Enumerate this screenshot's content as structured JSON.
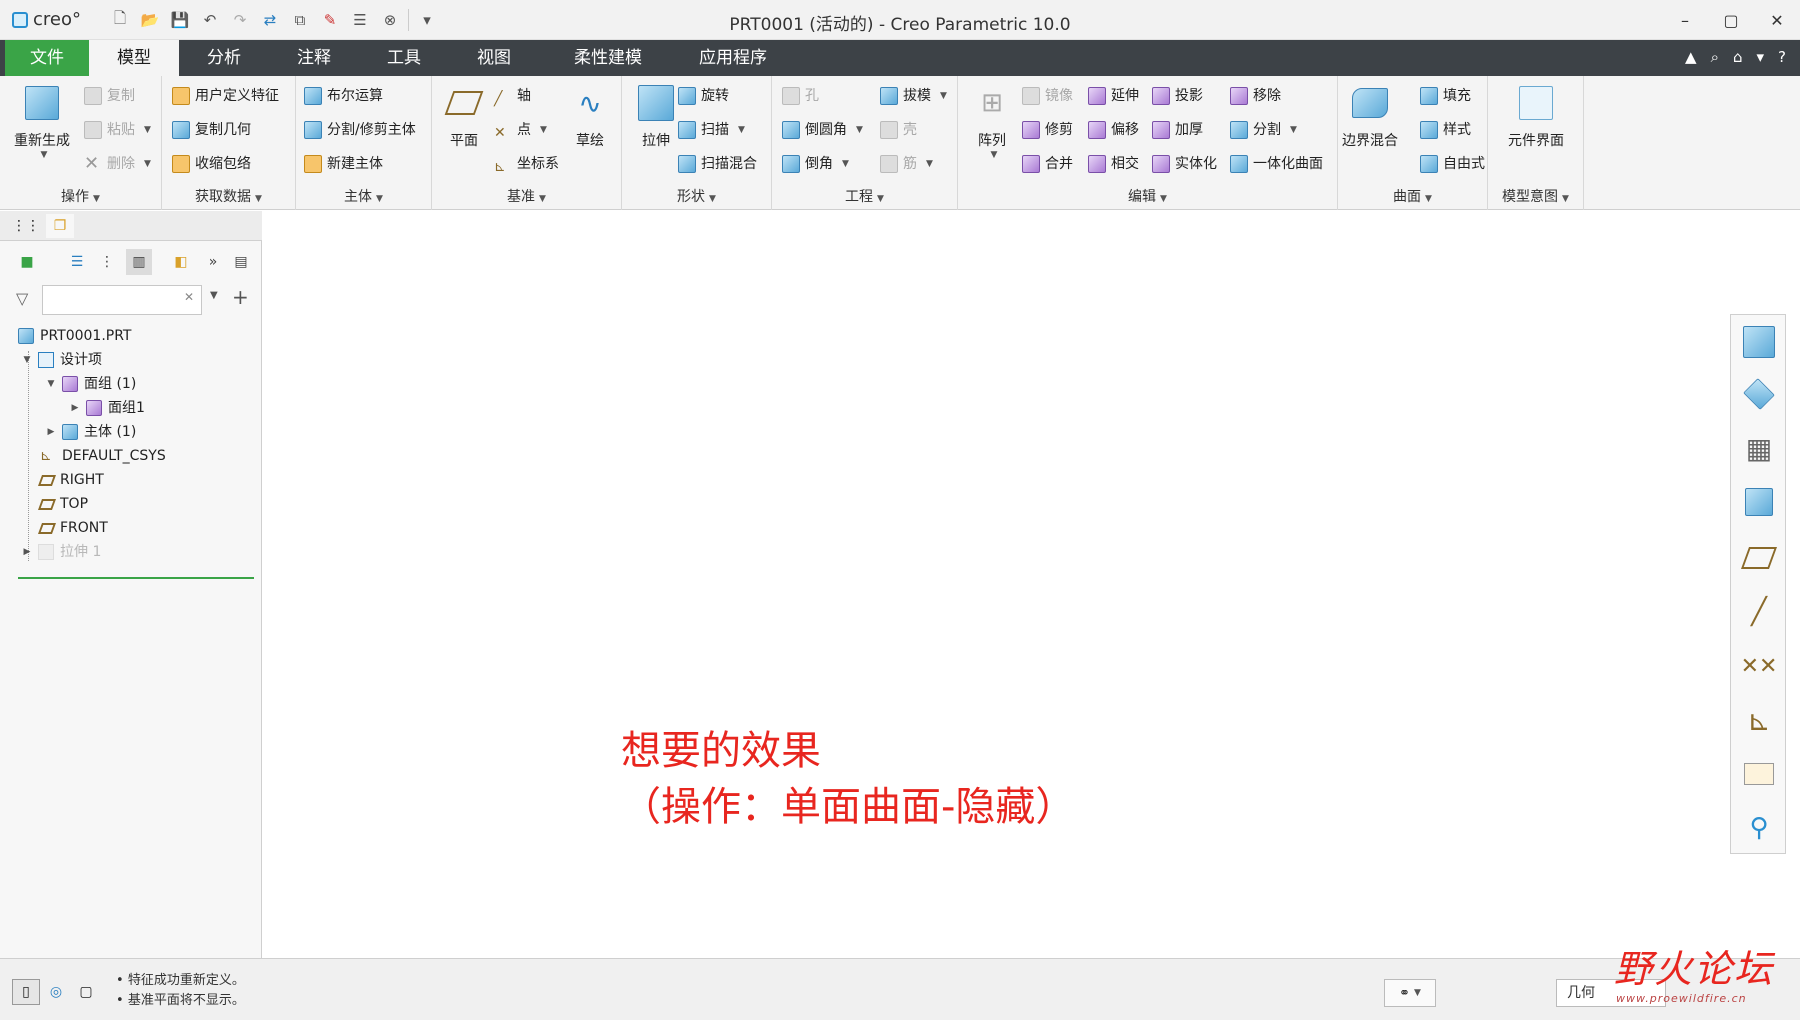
{
  "app": {
    "logo_text": "creo°",
    "title": "PRT0001 (活动的) - Creo Parametric 10.0"
  },
  "quick_access": [
    "new-icon",
    "open-icon",
    "save-icon",
    "undo-icon",
    "redo-icon",
    "regenerate-icon",
    "window-icon",
    "close-icon",
    "dropdown-icon"
  ],
  "window_controls": {
    "minimize": "–",
    "maximize": "▢",
    "close": "✕"
  },
  "menu": {
    "file": "文件",
    "tabs": [
      "模型",
      "分析",
      "注释",
      "工具",
      "视图",
      "柔性建模",
      "应用程序"
    ],
    "right_icons": [
      "▲",
      "⌕",
      "⌂",
      "▾",
      "?"
    ]
  },
  "ribbon": {
    "operations": {
      "label": "操作",
      "regen": "重新生成",
      "copy": "复制",
      "paste": "粘贴",
      "delete": "删除"
    },
    "get_data": {
      "label": "获取数据",
      "udf": "用户定义特征",
      "copy_geom": "复制几何",
      "shrinkwrap": "收缩包络"
    },
    "body": {
      "label": "主体",
      "boolean": "布尔运算",
      "split_trim": "分割/修剪主体",
      "new_body": "新建主体"
    },
    "datum": {
      "label": "基准",
      "plane": "平面",
      "axis": "轴",
      "point": "点",
      "csys": "坐标系",
      "sketch": "草绘"
    },
    "shapes": {
      "label": "形状",
      "extrude": "拉伸",
      "revolve": "旋转",
      "sweep": "扫描",
      "swept_blend": "扫描混合"
    },
    "engineering": {
      "label": "工程",
      "hole": "孔",
      "round": "倒圆角",
      "chamfer": "倒角",
      "draft": "拔模",
      "shell": "壳",
      "rib": "筋"
    },
    "editing": {
      "label": "编辑",
      "pattern": "阵列",
      "mirror": "镜像",
      "trim": "修剪",
      "merge": "合并",
      "extend": "延伸",
      "offset": "偏移",
      "intersect": "相交",
      "project": "投影",
      "thicken": "加厚",
      "solidify": "实体化",
      "remove": "移除",
      "split": "分割",
      "unify": "一体化曲面"
    },
    "surfaces": {
      "label": "曲面",
      "boundary": "边界混合",
      "fill": "填充",
      "style": "样式",
      "freestyle": "自由式"
    },
    "intent": {
      "label": "模型意图",
      "component_interface": "元件界面"
    }
  },
  "tree": {
    "search_placeholder": "",
    "nodes": [
      {
        "label": "PRT0001.PRT"
      },
      {
        "label": "设计项"
      },
      {
        "label": "面组 (1)"
      },
      {
        "label": "面组1"
      },
      {
        "label": "主体 (1)"
      },
      {
        "label": "DEFAULT_CSYS"
      },
      {
        "label": "RIGHT"
      },
      {
        "label": "TOP"
      },
      {
        "label": "FRONT"
      },
      {
        "label": "拉伸 1"
      }
    ]
  },
  "annotation": {
    "line1": "想要的效果",
    "line2": "（操作：单面曲面-隐藏）"
  },
  "status": {
    "messages": [
      "特征成功重新定义。",
      "基准平面将不显示。"
    ],
    "selection_filter": "几何"
  },
  "watermark": {
    "title": "野火论坛",
    "url": "www.proewildfire.cn"
  },
  "colors": {
    "file_tab": "#3aa447",
    "menubar": "#3d4247",
    "annotation": "#e8261f"
  }
}
